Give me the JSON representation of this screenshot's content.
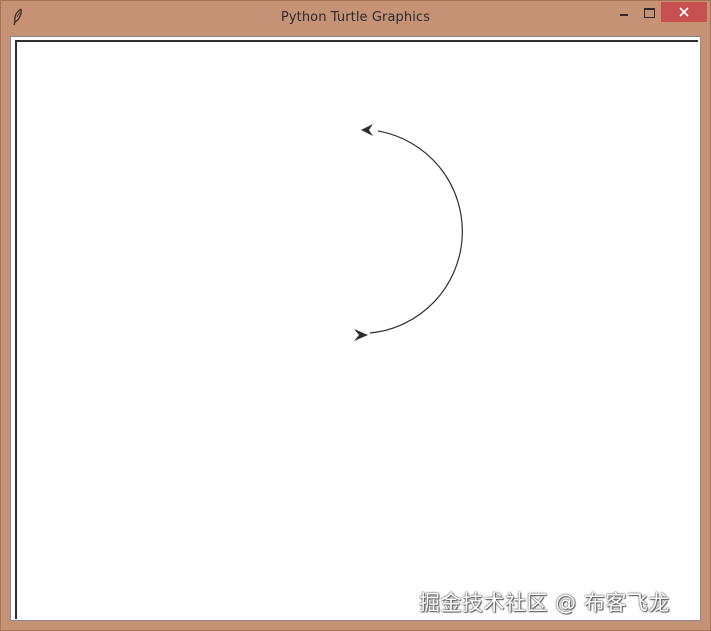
{
  "window": {
    "title": "Python Turtle Graphics",
    "icons": {
      "app": "feather-icon",
      "minimize": "minimize-icon",
      "maximize": "maximize-icon",
      "close": "close-icon",
      "turtle_cursor": "arrow-cursor-icon"
    },
    "colors": {
      "frame": "#c69275",
      "close_button": "#c75050",
      "pen": "#2e2e2e",
      "canvas": "#ffffff"
    }
  },
  "watermark": {
    "text": "掘金技术社区 @ 布客飞龙"
  }
}
